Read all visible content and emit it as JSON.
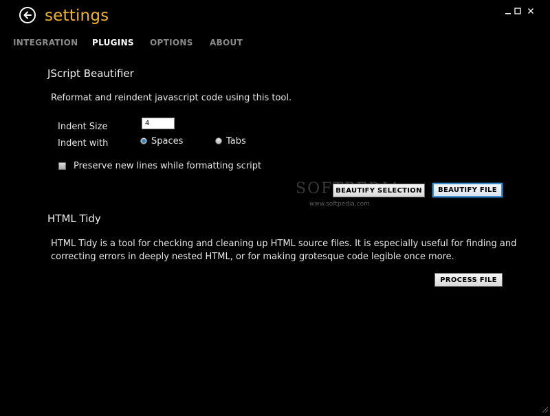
{
  "window": {
    "title": "settings",
    "controls": {
      "minimize": "–",
      "maximize": "□",
      "close": "✕"
    }
  },
  "tabs": [
    {
      "label": "INTEGRATION",
      "active": false
    },
    {
      "label": "PLUGINS",
      "active": true
    },
    {
      "label": "OPTIONS",
      "active": false
    },
    {
      "label": "ABOUT",
      "active": false
    }
  ],
  "jscript": {
    "title": "JScript Beautifier",
    "description": "Reformat and reindent javascript code using this tool.",
    "indent_size_label": "Indent Size",
    "indent_size_value": "4",
    "indent_with_label": "Indent with",
    "radio_spaces": "Spaces",
    "radio_tabs": "Tabs",
    "selected": "Spaces",
    "preserve_label": "Preserve new lines while formatting script",
    "preserve_checked": false,
    "beautify_selection": "BEAUTIFY SELECTION",
    "beautify_file": "BEAUTIFY FILE"
  },
  "tidy": {
    "title": "HTML Tidy",
    "description_line1": "HTML Tidy is a tool for checking and cleaning up HTML source files. It is especially useful for finding and",
    "description_line2": "correcting errors in deeply nested HTML, or for making grotesque code legible once more.",
    "process_file": "PROCESS FILE"
  },
  "watermark": {
    "logo": "SOFTPEDIA",
    "url": "www.softpedia.com"
  },
  "colors": {
    "background": "#000000",
    "title_accent": "#f0b429",
    "default_button_border": "#3c8fd3",
    "radio_dot": "#2f86c5"
  }
}
